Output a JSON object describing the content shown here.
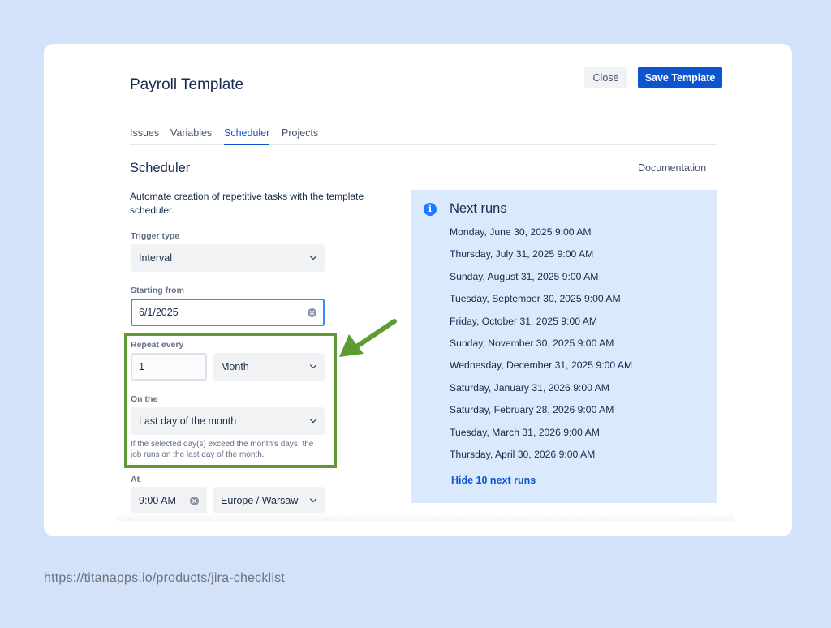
{
  "header": {
    "title": "Payroll Template",
    "close_label": "Close",
    "save_label": "Save Template"
  },
  "tabs": [
    {
      "label": "Issues",
      "active": false
    },
    {
      "label": "Variables",
      "active": false
    },
    {
      "label": "Scheduler",
      "active": true
    },
    {
      "label": "Projects",
      "active": false
    }
  ],
  "scheduler": {
    "title": "Scheduler",
    "documentation_label": "Documentation",
    "description": "Automate creation of repetitive tasks with the template scheduler.",
    "trigger_type": {
      "label": "Trigger type",
      "value": "Interval"
    },
    "starting_from": {
      "label": "Starting from",
      "value": "6/1/2025"
    },
    "repeat_every": {
      "label": "Repeat every",
      "count": "1",
      "unit": "Month"
    },
    "on_the": {
      "label": "On the",
      "value": "Last day of the month"
    },
    "helper_text": "If the selected day(s) exceed the month's days, the job runs on the last day of the month.",
    "at": {
      "label": "At",
      "time": "9:00 AM",
      "timezone": "Europe / Warsaw"
    }
  },
  "next_runs": {
    "title": "Next runs",
    "runs": [
      "Monday, June 30, 2025 9:00 AM",
      "Thursday, July 31, 2025 9:00 AM",
      "Sunday, August 31, 2025 9:00 AM",
      "Tuesday, September 30, 2025 9:00 AM",
      "Friday, October 31, 2025 9:00 AM",
      "Sunday, November 30, 2025 9:00 AM",
      "Wednesday, December 31, 2025 9:00 AM",
      "Saturday, January 31, 2026 9:00 AM",
      "Saturday, February 28, 2026 9:00 AM",
      "Tuesday, March 31, 2026 9:00 AM",
      "Thursday, April 30, 2026 9:00 AM"
    ],
    "hide_label": "Hide 10 next runs"
  },
  "footer": {
    "url": "https://titanapps.io/products/jira-checklist"
  },
  "colors": {
    "background": "#d3e2f8",
    "primary": "#0c55cf",
    "highlight": "#5e9c33",
    "panel": "#dae9fc"
  },
  "icons": {
    "clear": "clear-icon",
    "chevron": "chevron-down-icon",
    "info": "info-icon",
    "arrow": "arrow-icon"
  }
}
